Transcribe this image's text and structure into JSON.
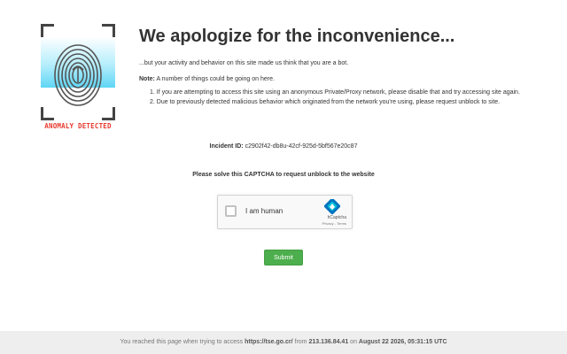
{
  "logo": {
    "badge_text": "ANOMALY DETECTED",
    "badge_color": "#e8382d",
    "scan_color": "#5fd6f5"
  },
  "header": {
    "title": "We apologize for the inconvenience..."
  },
  "message": {
    "lead": "...but your activity and behavior on this site made us think that you are a bot.",
    "note_label": "Note:",
    "note_text": "A number of things could be going on here.",
    "reasons": [
      "1. If you are attempting to access this site using an anonymous Private/Proxy network, please disable that and try accessing site again.",
      "2. Due to previously detected malicious behavior which originated from the network you're using, please request unblock to site."
    ]
  },
  "incident": {
    "label": "Incident ID:",
    "id": "c2902f42-db8u-42cf-925d-5bf567e20c87"
  },
  "captcha": {
    "prompt": "Please solve this CAPTCHA to request unblock to the website",
    "checkbox_label": "I am human",
    "brand": "hCaptcha",
    "links": "Privacy - Terms"
  },
  "form": {
    "submit_label": "Submit",
    "submit_color": "#4cae4c"
  },
  "footer": {
    "prefix": "You reached this page when trying to access",
    "url": "https://tse.go.cr/",
    "from_text": "from",
    "ip": "213.136.84.41",
    "on_text": "on",
    "datetime": "August 22 2026, 05:31:15 UTC"
  }
}
